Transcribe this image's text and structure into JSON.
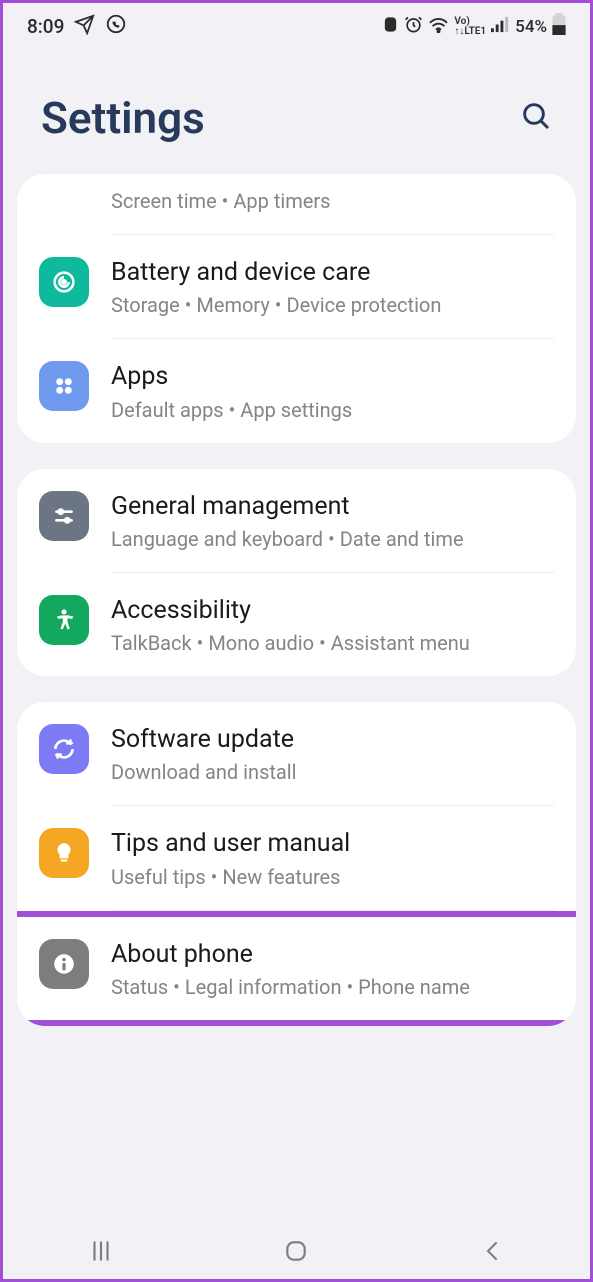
{
  "status": {
    "time": "8:09",
    "battery_pct": "54%",
    "lte_top": "Vo)",
    "lte_bot": "LTE1"
  },
  "header": {
    "title": "Settings"
  },
  "groups": [
    {
      "items": [
        {
          "title": "",
          "sub": "Screen time  •  App timers",
          "no_icon": true
        },
        {
          "title": "Battery and device care",
          "sub": "Storage  •  Memory  •  Device protection",
          "icon": "battery-care",
          "icon_bg": "#0fb99d",
          "icon_fg": "#ffffff"
        },
        {
          "title": "Apps",
          "sub": "Default apps  •  App settings",
          "icon": "apps",
          "icon_bg": "#6f9af0",
          "icon_fg": "#ffffff"
        }
      ]
    },
    {
      "items": [
        {
          "title": "General management",
          "sub": "Language and keyboard  •  Date and time",
          "icon": "sliders",
          "icon_bg": "#6c7584",
          "icon_fg": "#ffffff"
        },
        {
          "title": "Accessibility",
          "sub": "TalkBack  •  Mono audio  •  Assistant menu",
          "icon": "accessibility",
          "icon_bg": "#12a85d",
          "icon_fg": "#ffffff"
        }
      ]
    },
    {
      "items": [
        {
          "title": "Software update",
          "sub": "Download and install",
          "icon": "update",
          "icon_bg": "#7c7af5",
          "icon_fg": "#ffffff"
        },
        {
          "title": "Tips and user manual",
          "sub": "Useful tips  •  New features",
          "icon": "tips",
          "icon_bg": "#f5a623",
          "icon_fg": "#ffffff"
        },
        {
          "title": "About phone",
          "sub": "Status  •  Legal information  •  Phone name",
          "icon": "info",
          "icon_bg": "#7d7d7d",
          "icon_fg": "#ffffff",
          "highlight": true
        }
      ]
    }
  ]
}
